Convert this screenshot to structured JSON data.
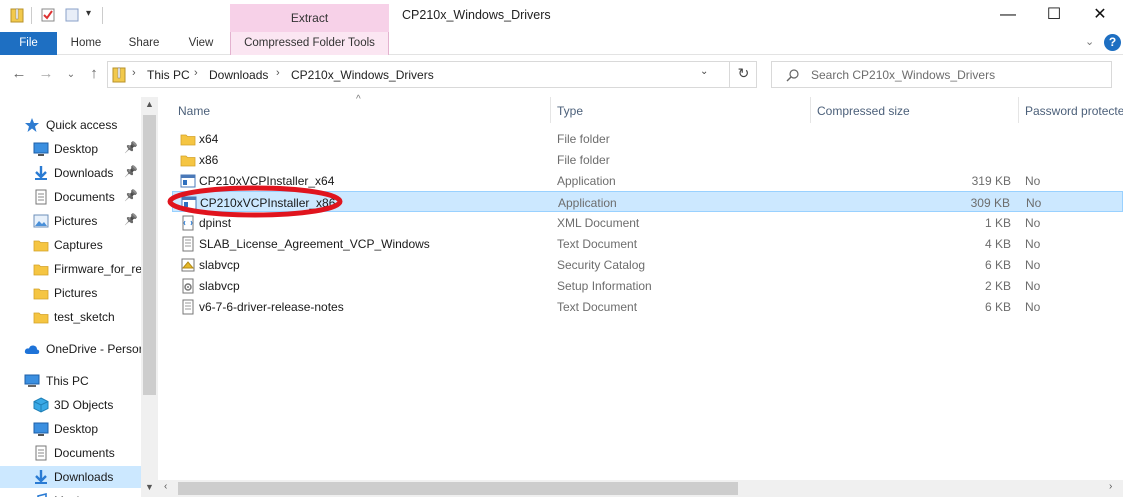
{
  "window": {
    "title": "CP210x_Windows_Drivers",
    "context_group": "Extract",
    "controls": {
      "minimize": "—",
      "maximize": "☐",
      "close": "✕"
    }
  },
  "ribbon": {
    "tabs": [
      "File",
      "Home",
      "Share",
      "View"
    ],
    "context_tab": "Compressed Folder Tools",
    "help": "?"
  },
  "address": {
    "crumbs": [
      "This PC",
      "Downloads",
      "CP210x_Windows_Drivers"
    ],
    "separator": "›",
    "search_placeholder": "Search CP210x_Windows_Drivers"
  },
  "nav": {
    "items": [
      {
        "label": "Quick access",
        "icon": "star-icon",
        "pinned": false
      },
      {
        "label": "Desktop",
        "icon": "desktop-icon",
        "pinned": true
      },
      {
        "label": "Downloads",
        "icon": "download-icon",
        "pinned": true
      },
      {
        "label": "Documents",
        "icon": "documents-icon",
        "pinned": true
      },
      {
        "label": "Pictures",
        "icon": "pictures-icon",
        "pinned": true
      },
      {
        "label": "Captures",
        "icon": "folder-icon",
        "pinned": false
      },
      {
        "label": "Firmware_for_re",
        "icon": "folder-icon",
        "pinned": false
      },
      {
        "label": "Pictures",
        "icon": "folder-icon",
        "pinned": false
      },
      {
        "label": "test_sketch",
        "icon": "folder-icon",
        "pinned": false
      },
      {
        "label": "OneDrive - Persor",
        "icon": "cloud-icon",
        "pinned": false
      },
      {
        "label": "This PC",
        "icon": "computer-icon",
        "pinned": false
      },
      {
        "label": "3D Objects",
        "icon": "cube-icon",
        "pinned": false
      },
      {
        "label": "Desktop",
        "icon": "desktop-icon",
        "pinned": false
      },
      {
        "label": "Documents",
        "icon": "documents-icon",
        "pinned": false
      },
      {
        "label": "Downloads",
        "icon": "download-icon",
        "pinned": false
      },
      {
        "label": "Music",
        "icon": "music-icon",
        "pinned": false
      }
    ]
  },
  "columns": [
    "Name",
    "Type",
    "Compressed size",
    "Password protecte"
  ],
  "files": [
    {
      "name": "x64",
      "type": "File folder",
      "size": "",
      "password": "",
      "icon": "folder-icon"
    },
    {
      "name": "x86",
      "type": "File folder",
      "size": "",
      "password": "",
      "icon": "folder-icon"
    },
    {
      "name": "CP210xVCPInstaller_x64",
      "type": "Application",
      "size": "319 KB",
      "password": "No",
      "icon": "app-icon"
    },
    {
      "name": "CP210xVCPInstaller_x86",
      "type": "Application",
      "size": "309 KB",
      "password": "No",
      "icon": "app-icon"
    },
    {
      "name": "dpinst",
      "type": "XML Document",
      "size": "1 KB",
      "password": "No",
      "icon": "xml-icon"
    },
    {
      "name": "SLAB_License_Agreement_VCP_Windows",
      "type": "Text Document",
      "size": "4 KB",
      "password": "No",
      "icon": "text-file-icon"
    },
    {
      "name": "slabvcp",
      "type": "Security Catalog",
      "size": "6 KB",
      "password": "No",
      "icon": "catalog-icon"
    },
    {
      "name": "slabvcp",
      "type": "Setup Information",
      "size": "2 KB",
      "password": "No",
      "icon": "setup-icon"
    },
    {
      "name": "v6-7-6-driver-release-notes",
      "type": "Text Document",
      "size": "6 KB",
      "password": "No",
      "icon": "text-file-icon"
    }
  ],
  "selected_index": 3,
  "colors": {
    "file_tab": "#1e6fc2",
    "context_tab": "#f7d1e8",
    "selection": "#cce8ff",
    "annotation": "#e0141e"
  }
}
